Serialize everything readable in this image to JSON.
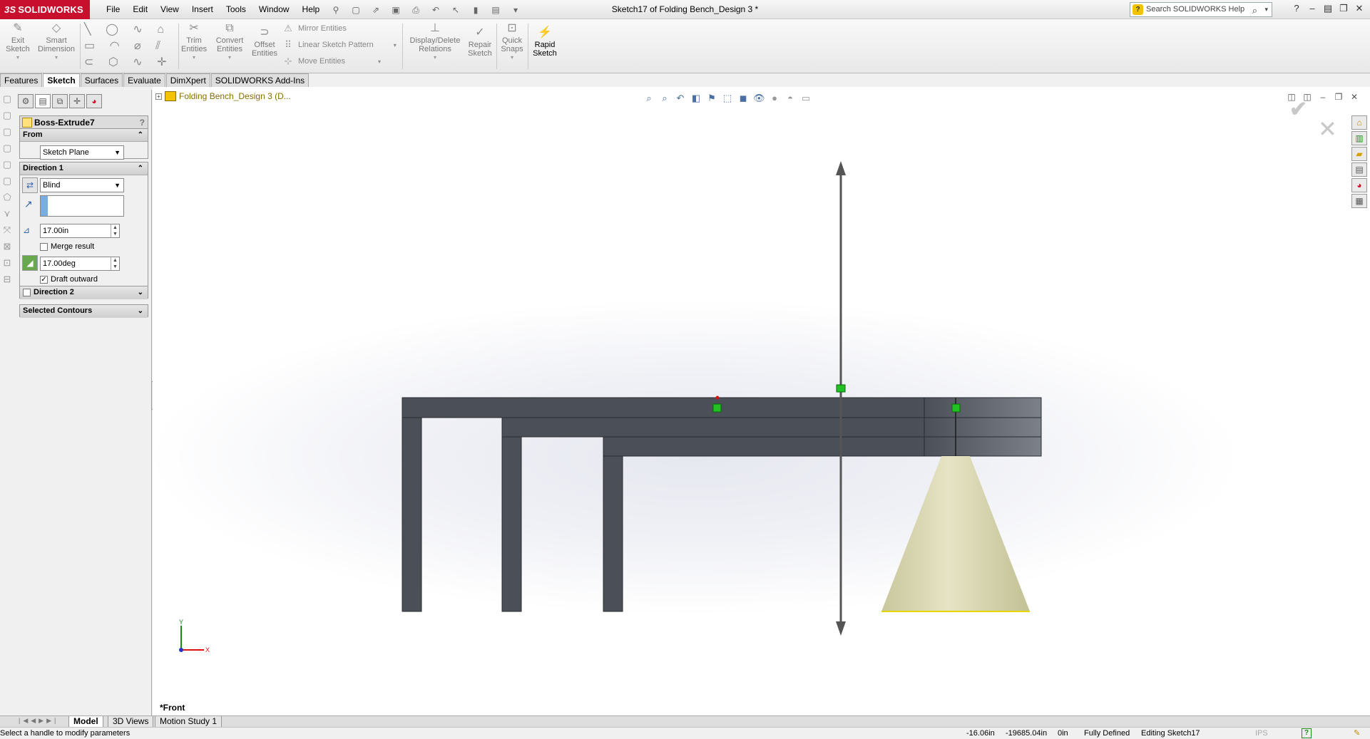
{
  "app": {
    "logo_text": "SOLIDWORKS",
    "logo_mark": "3S",
    "document_title": "Sketch17 of Folding Bench_Design 3 *"
  },
  "menu": [
    "File",
    "Edit",
    "View",
    "Insert",
    "Tools",
    "Window",
    "Help"
  ],
  "search": {
    "placeholder": "Search SOLIDWORKS Help"
  },
  "command_manager": {
    "exit_sketch": "Exit\nSketch",
    "smart_dimension": "Smart\nDimension",
    "trim_entities": "Trim\nEntities",
    "convert_entities": "Convert\nEntities",
    "offset_entities": "Offset\nEntities",
    "mirror_entities": "Mirror Entities",
    "linear_sketch_pattern": "Linear Sketch Pattern",
    "move_entities": "Move Entities",
    "display_delete_relations": "Display/Delete\nRelations",
    "repair_sketch": "Repair\nSketch",
    "quick_snaps": "Quick\nSnaps",
    "rapid_sketch": "Rapid\nSketch"
  },
  "tabs": [
    {
      "label": "Features",
      "active": false
    },
    {
      "label": "Sketch",
      "active": true
    },
    {
      "label": "Surfaces",
      "active": false
    },
    {
      "label": "Evaluate",
      "active": false
    },
    {
      "label": "DimXpert",
      "active": false
    },
    {
      "label": "SOLIDWORKS Add-Ins",
      "active": false
    }
  ],
  "property_manager": {
    "title": "Boss-Extrude7",
    "help": "?",
    "from": {
      "label": "From",
      "value": "Sketch Plane"
    },
    "direction1": {
      "label": "Direction 1",
      "end_condition": "Blind",
      "depth": "17.00in",
      "merge_result_label": "Merge result",
      "merge_result_checked": false,
      "draft_angle": "17.00deg",
      "draft_outward_label": "Draft outward",
      "draft_outward_checked": true
    },
    "direction2": {
      "label": "Direction 2",
      "checked": false
    },
    "selected_contours": {
      "label": "Selected Contours"
    }
  },
  "viewport": {
    "tree_root": "Folding Bench_Design 3  (D...",
    "view_label": "*Front",
    "axis_y": "Y",
    "axis_x": "X"
  },
  "bottom_tabs": [
    {
      "label": "Model",
      "active": true
    },
    {
      "label": "3D Views",
      "active": false
    },
    {
      "label": "Motion Study 1",
      "active": false
    }
  ],
  "status": {
    "message": "Select a handle to modify parameters",
    "x": "-16.06in",
    "y": "-19685.04in",
    "z": "0in",
    "state": "Fully Defined",
    "editing": "Editing Sketch17",
    "units": "IPS",
    "help_glyph": "?"
  },
  "colors": {
    "bench": "#4b4f58",
    "cone": "#d8d6b0",
    "logo": "#c8102e",
    "ok": "#1e9b1e",
    "cancel": "#d11111"
  }
}
